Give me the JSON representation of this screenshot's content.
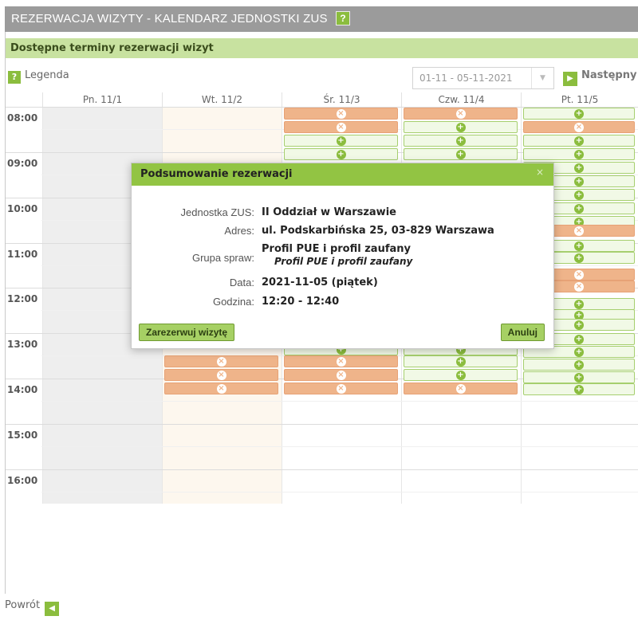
{
  "header": {
    "title": "REZERWACJA WIZYTY - KALENDARZ JEDNOSTKI ZUS",
    "help": "?"
  },
  "subtitle": "Dostępne terminy rezerwacji wizyt",
  "legend": {
    "icon": "?",
    "label": "Legenda"
  },
  "daterange": {
    "value": "01-11 - 05-11-2021"
  },
  "next": {
    "label": "Następny"
  },
  "calendar": {
    "days": [
      "Pn. 11/1",
      "Wt. 11/2",
      "Śr. 11/3",
      "Czw. 11/4",
      "Pt. 11/5"
    ],
    "hours": [
      "08:00",
      "09:00",
      "10:00",
      "11:00",
      "12:00",
      "13:00",
      "14:00",
      "15:00",
      "16:00"
    ]
  },
  "modal": {
    "title": "Podsumowanie rezerwacji",
    "close": "×",
    "unit_label": "Jednostka ZUS:",
    "unit_value": "II Oddział w Warszawie",
    "address_label": "Adres:",
    "address_value": "ul. Podskarbińska 25, 03-829 Warszawa",
    "group_label": "Grupa spraw:",
    "group_value": "Profil PUE i profil zaufany",
    "group_sub": "Profil PUE i profil zaufany",
    "date_label": "Data:",
    "date_value": "2021-11-05 (piątek)",
    "time_label": "Godzina:",
    "time_value": "12:20 - 12:40",
    "reserve_label": "Zarezerwuj wizytę",
    "cancel_label": "Anuluj"
  },
  "footer": {
    "back_label": "Powrót"
  },
  "colors": {
    "accent": "#8bbd3e",
    "free": "#f1f9e6",
    "busy": "#efb48a",
    "header": "#9b9b9b"
  }
}
